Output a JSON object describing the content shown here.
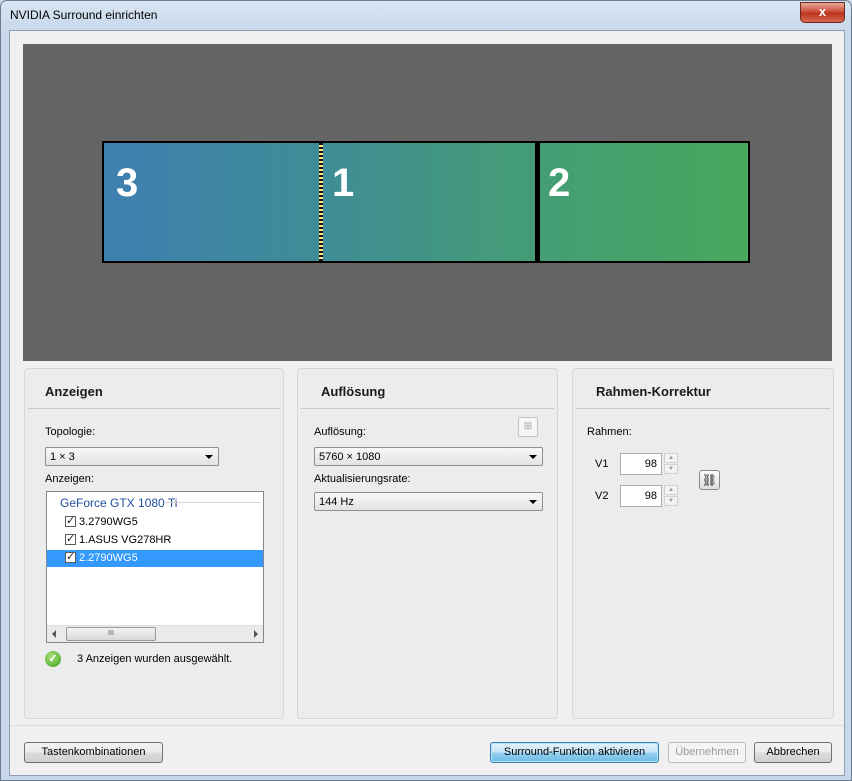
{
  "window": {
    "title": "NVIDIA Surround einrichten",
    "close_glyph": "x"
  },
  "preview": {
    "screens": [
      {
        "number": "3"
      },
      {
        "number": "1"
      },
      {
        "number": "2"
      }
    ]
  },
  "anzeigen_panel": {
    "title": "Anzeigen",
    "topology_label": "Topologie:",
    "topology_value": "1 × 3",
    "displays_label": "Anzeigen:",
    "gpu": "GeForce GTX 1080 Ti",
    "displays": [
      {
        "label": "3.2790WG5",
        "checked": true,
        "selected": false
      },
      {
        "label": "1.ASUS VG278HR",
        "checked": true,
        "selected": false
      },
      {
        "label": "2.2790WG5",
        "checked": true,
        "selected": true
      }
    ],
    "scroll_thumb": "III",
    "status": "3 Anzeigen wurden ausgewählt."
  },
  "aufloesung_panel": {
    "title": "Auflösung",
    "resolution_label": "Auflösung:",
    "resolution_value": "5760 × 1080",
    "refresh_label": "Aktualisierungsrate:",
    "refresh_value": "144 Hz"
  },
  "rahmen_panel": {
    "title": "Rahmen-Korrektur",
    "rahmen_label": "Rahmen:",
    "v1_label": "V1",
    "v1_value": "98",
    "v2_label": "V2",
    "v2_value": "98"
  },
  "footer": {
    "shortcuts_button": "Tastenkombinationen",
    "activate_button": "Surround-Funktion aktivieren",
    "apply_button": "Übernehmen",
    "cancel_button": "Abbrechen"
  },
  "colors": {
    "preview_bg": "#646464",
    "surround_left": "#3e7fb0",
    "surround_right": "#48a85c",
    "selection": "#3399ff"
  }
}
